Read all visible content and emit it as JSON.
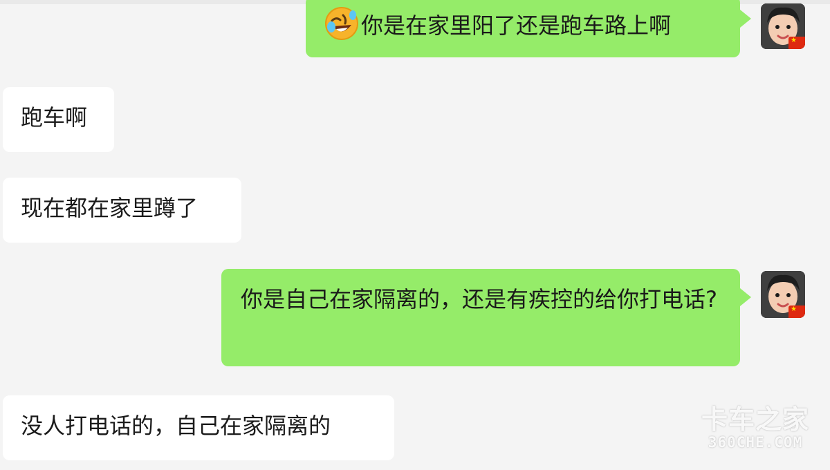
{
  "conversation": {
    "messages": [
      {
        "sender": "self",
        "emoji": "rolling-on-floor-laughing-emoji",
        "text": "你是在家里阳了还是跑车路上啊"
      },
      {
        "sender": "other",
        "text": "跑车啊"
      },
      {
        "sender": "other",
        "text": "现在都在家里蹲了"
      },
      {
        "sender": "self",
        "text": "你是自己在家隔离的，还是有疾控的给你打电话?"
      },
      {
        "sender": "other",
        "text": "没人打电话的，自己在家隔离的"
      }
    ]
  },
  "watermark": {
    "brand": "卡车之家",
    "site": "360CHE.COM"
  },
  "colors": {
    "background": "#f4f4f4",
    "self_bubble": "#95ec69",
    "other_bubble": "#ffffff",
    "text": "#1a1a1a"
  }
}
